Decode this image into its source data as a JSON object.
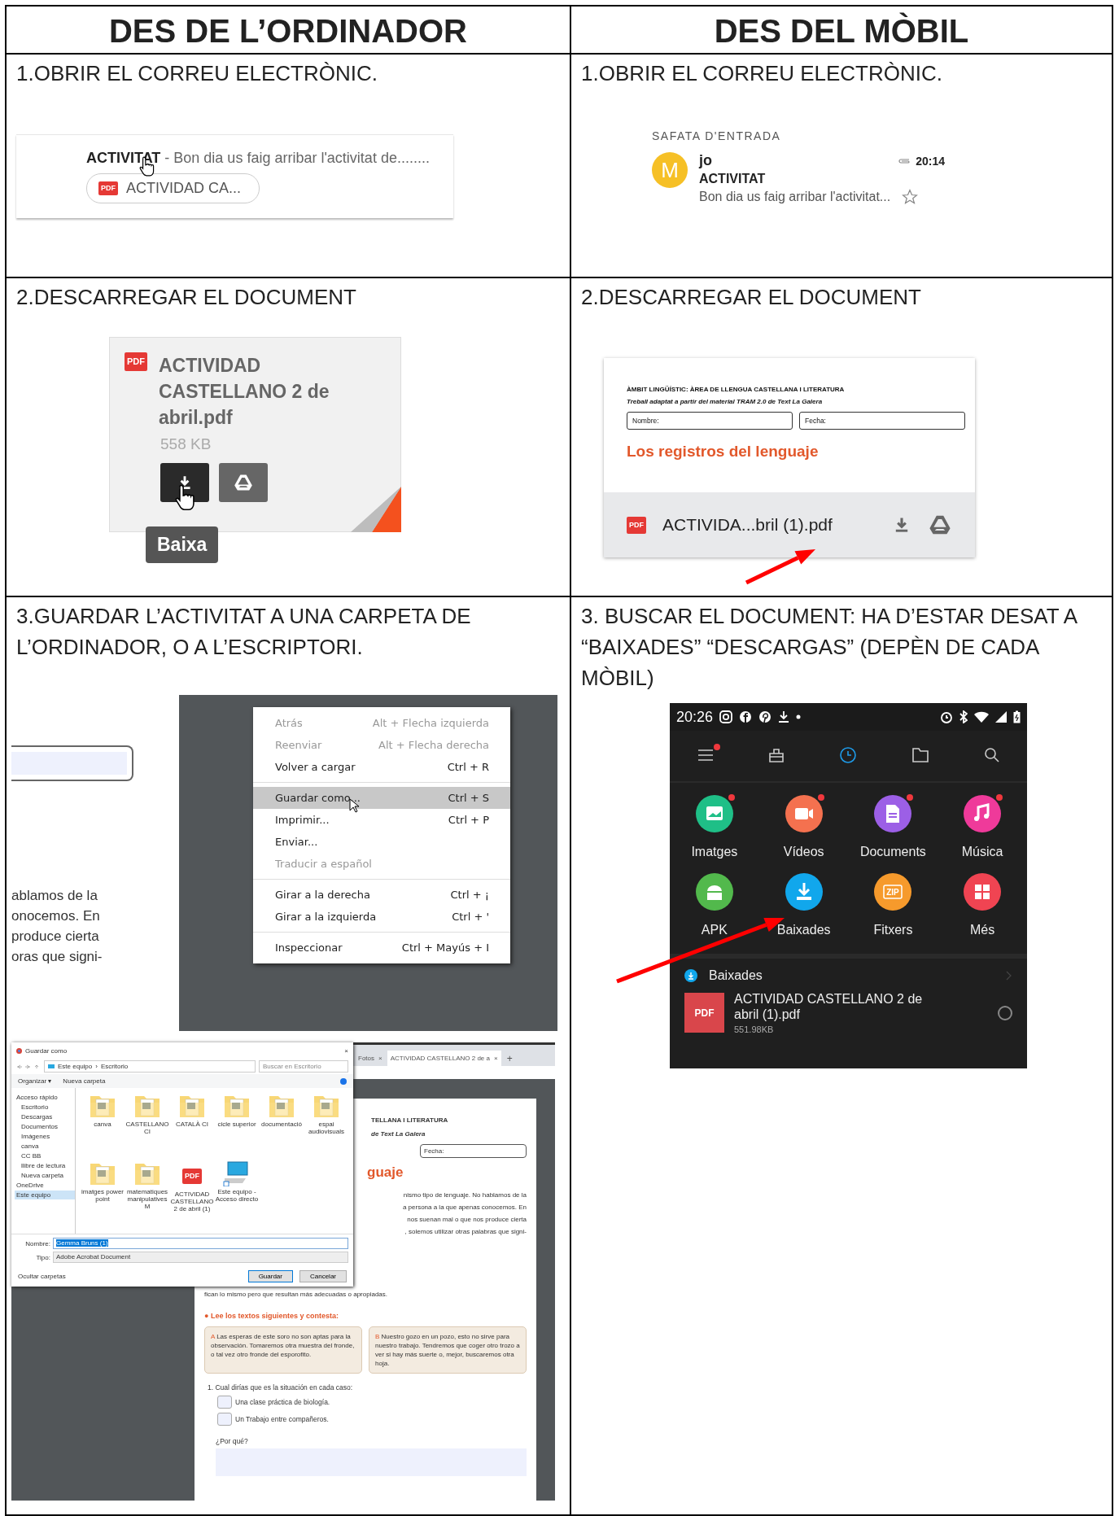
{
  "columns": [
    {
      "title": "DES DE L’ORDINADOR"
    },
    {
      "title": "DES DEL MÒBIL"
    }
  ],
  "rows": [
    {
      "cells": [
        {
          "heading": "1.OBRIR EL CORREU ELECTRÒNIC.",
          "figure": {
            "kind": "mail_row",
            "line": "**ACTIVITAT** - Bon dia us faig arribar l'activitat de........",
            "badge": "PDF",
            "attachment": "ACTIVIDAD CA..."
          }
        },
        {
          "heading": "1.OBRIR EL CORREU ELECTRÒNIC.",
          "figure": {
            "kind": "inbox",
            "section": "SAFATA D'ENTRADA",
            "avatar": "M",
            "sender": "jo",
            "time": "20:14",
            "subject": "ACTIVITAT",
            "snippet": "Bon dia us faig arribar l'activitat...",
            "starred": false
          }
        }
      ]
    },
    {
      "cells": [
        {
          "heading": "2.DESCARREGAR EL DOCUMENT",
          "figure": {
            "kind": "attachment_card",
            "badge": "PDF",
            "name": "ACTIVIDAD CASTELLANO 2 de abril.pdf",
            "size": "558 KB",
            "tooltip": "Baixa"
          }
        },
        {
          "heading": "2.DESCARREGAR EL DOCUMENT",
          "figure": {
            "kind": "pdf_preview",
            "lines": [
              "ÀMBIT LINGÜÍSTIC: ÀREA DE LLENGUA CASTELLANA I LITERATURA",
              "Treball adaptat a partir del material TRAM 2.0 de Text La Galera"
            ],
            "fields": [
              "Nombre:",
              "Fecha:"
            ],
            "title": "Los registros del lenguaje",
            "badge": "PDF",
            "filename": "ACTIVIDA...bril (1).pdf",
            "pointer_arrow": true
          }
        }
      ]
    },
    {
      "cells": [
        {
          "heading": "3.GUARDAR L’ACTIVITAT A UNA CARPETA DE L’ORDINADOR, O A L’ESCRIPTORI.",
          "figures": [
            {
              "kind": "context_menu",
              "page_text": [
                "ablamos de la",
                "onocemos. En",
                "produce cierta",
                "oras que signi-"
              ],
              "groups": [
                [
                  {
                    "label": "Atrás",
                    "shortcut": "Alt + Flecha izquierda",
                    "disabled": true,
                    "selected": false
                  },
                  {
                    "label": "Reenviar",
                    "shortcut": "Alt + Flecha derecha",
                    "disabled": true,
                    "selected": false
                  },
                  {
                    "label": "Volver a cargar",
                    "shortcut": "Ctrl + R",
                    "disabled": false,
                    "selected": false
                  }
                ],
                [
                  {
                    "label": "Guardar como...",
                    "shortcut": "Ctrl + S",
                    "disabled": false,
                    "selected": true
                  },
                  {
                    "label": "Imprimir...",
                    "shortcut": "Ctrl + P",
                    "disabled": false,
                    "selected": false
                  },
                  {
                    "label": "Enviar...",
                    "disabled": false,
                    "selected": false
                  },
                  {
                    "label": "Traducir a español",
                    "disabled": true,
                    "selected": false
                  }
                ],
                [
                  {
                    "label": "Girar a la derecha",
                    "shortcut": "Ctrl + ¡",
                    "disabled": false,
                    "selected": false
                  },
                  {
                    "label": "Girar a la izquierda",
                    "shortcut": "Ctrl + '",
                    "disabled": false,
                    "selected": false
                  }
                ],
                [
                  {
                    "label": "Inspeccionar",
                    "shortcut": "Ctrl + Mayús + I",
                    "disabled": false,
                    "selected": false
                  }
                ]
              ]
            },
            {
              "kind": "save_dialog",
              "tabs": [
                {
                  "label": "Fotos",
                  "close": "×",
                  "selected": false
                },
                {
                  "label": "ACTIVIDAD CASTELLANO 2 de a",
                  "close": "×",
                  "selected": true
                }
              ],
              "new_tab": "+",
              "dialog": {
                "title": "Guardar como",
                "close": "×",
                "path": [
                  "Este equipo",
                  "Escritorio"
                ],
                "path_separator": "›",
                "search_placeholder": "Buscar en Escritorio",
                "organize": "Organizar ▾",
                "new_folder": "Nueva carpeta",
                "sidebar": [
                  {
                    "label": "Acceso rápido",
                    "selected": false
                  },
                  {
                    "label": "Escritorio",
                    "selected": false
                  },
                  {
                    "label": "Descargas",
                    "selected": false
                  },
                  {
                    "label": "Documentos",
                    "selected": false
                  },
                  {
                    "label": "Imágenes",
                    "selected": false
                  },
                  {
                    "label": "canva",
                    "selected": false
                  },
                  {
                    "label": "CC BB",
                    "selected": false
                  },
                  {
                    "label": "llibre de lectura",
                    "selected": false
                  },
                  {
                    "label": "Nueva carpeta",
                    "selected": false
                  },
                  {
                    "label": "OneDrive",
                    "selected": false
                  },
                  {
                    "label": "Este equipo",
                    "selected": true
                  }
                ],
                "files": [
                  {
                    "kind": "folder",
                    "label": "canva"
                  },
                  {
                    "kind": "folder",
                    "label": "CASTELLANO CI"
                  },
                  {
                    "kind": "folder",
                    "label": "CATALÀ CI"
                  },
                  {
                    "kind": "folder",
                    "label": "cicle superior"
                  },
                  {
                    "kind": "folder",
                    "label": "documentació"
                  },
                  {
                    "kind": "folder",
                    "label": "espai audiovisuals"
                  },
                  {
                    "kind": "folder",
                    "label": "imatges power point"
                  },
                  {
                    "kind": "folder",
                    "label": "matematiques manipulatives M"
                  },
                  {
                    "kind": "pdf",
                    "label": "ACTIVIDAD CASTELLANO 2 de abril (1)",
                    "badge": "PDF"
                  },
                  {
                    "kind": "computer",
                    "label": "Este equipo - Acceso directo"
                  }
                ],
                "name_label": "Nombre:",
                "name_value": "Gemma Bruns (1)",
                "type_label": "Tipo:",
                "type_value": "Adobe Acrobat Document",
                "hide_folders": "Ocultar carpetas",
                "save": "Guardar",
                "cancel": "Cancelar"
              },
              "page": {
                "header": [
                  "TELLANA I LITERATURA",
                  "de Text La Galera"
                ],
                "field": "Fecha:",
                "title": "guaje",
                "paragraph": [
                  "nismo tipo de lenguaje. No hablamos de la",
                  "a persona a la que apenas conocemos. En",
                  "nos suenan mal o que nos produce cierta",
                  ", solemos utilizar otras palabras que signi-",
                  "fican lo mismo pero que resultan más adecuadas o apropiadas."
                ],
                "prompt": "● Lee los textos siguientes y contesta:",
                "boxes": [
                  {
                    "letter": "A",
                    "text": "Las esperas de este soro no son aptas para la observación. Tomaremos otra muestra del fronde, o tal vez otro fronde del esporofito."
                  },
                  {
                    "letter": "B",
                    "text": "Nuestro gozo en un pozo, esto no sirve para nuestro trabajo. Tendremos que coger otro trozo a ver si hay más suerte o, mejor, buscaremos otra hoja."
                  }
                ],
                "question": "1.  Cual dirías que es la situación en cada caso:",
                "options": [
                  {
                    "label": "Una clase práctica de biología.",
                    "checked": false
                  },
                  {
                    "label": "Un Trabajo entre compañeros.",
                    "checked": false
                  }
                ],
                "why": "¿Por qué?"
              }
            }
          ]
        },
        {
          "heading": "3. BUSCAR EL DOCUMENT: HA D’ESTAR DESAT A “BAIXADES” “DESCARGAS” (DEPÈN DE CADA MÒBIL)",
          "figure": {
            "kind": "file_manager",
            "time": "20:26",
            "tabs": [
              {
                "kind": "menu",
                "selected": false,
                "dot": true
              },
              {
                "kind": "tools",
                "selected": false,
                "dot": false
              },
              {
                "kind": "recent",
                "selected": true,
                "dot": false
              },
              {
                "kind": "folder",
                "selected": false,
                "dot": false
              },
              {
                "kind": "search",
                "selected": false,
                "dot": false
              }
            ],
            "categories": [
              {
                "kind": "images",
                "label": "Imatges",
                "color": "#1fbf87",
                "dot": true
              },
              {
                "kind": "video",
                "label": "Vídeos",
                "color": "#f4714f",
                "dot": true
              },
              {
                "kind": "docs",
                "label": "Documents",
                "color": "#9c5fe6",
                "dot": true
              },
              {
                "kind": "music",
                "label": "Música",
                "color": "#ef3a9a",
                "dot": true
              },
              {
                "kind": "apk",
                "label": "APK",
                "color": "#52b94c",
                "dot": false
              },
              {
                "kind": "download",
                "label": "Baixades",
                "color": "#11a7ec",
                "dot": false
              },
              {
                "kind": "zip",
                "label": "Fitxers",
                "color": "#f69a2c",
                "dot": false,
                "glyph": "ZIP"
              },
              {
                "kind": "more",
                "label": "Més",
                "color": "#f04452",
                "dot": false
              }
            ],
            "section": "Baixades",
            "file": {
              "badge": "PDF",
              "name": "ACTIVIDAD CASTELLANO 2 de abril (1).pdf",
              "size": "551.98KB",
              "selected": false
            },
            "pointer_arrow": true
          }
        }
      ]
    }
  ]
}
